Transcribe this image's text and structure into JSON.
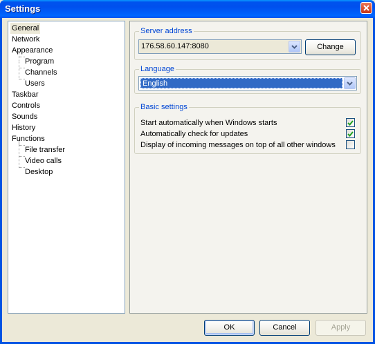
{
  "window": {
    "title": "Settings",
    "close_icon": "close-icon"
  },
  "tree": {
    "items": [
      {
        "label": "General",
        "level": 0,
        "selected": true
      },
      {
        "label": "Network",
        "level": 0
      },
      {
        "label": "Appearance",
        "level": 0
      },
      {
        "label": "Program",
        "level": 1
      },
      {
        "label": "Channels",
        "level": 1
      },
      {
        "label": "Users",
        "level": 1
      },
      {
        "label": "Taskbar",
        "level": 0
      },
      {
        "label": "Controls",
        "level": 0
      },
      {
        "label": "Sounds",
        "level": 0
      },
      {
        "label": "History",
        "level": 0
      },
      {
        "label": "Functions",
        "level": 0
      },
      {
        "label": "File transfer",
        "level": 1
      },
      {
        "label": "Video calls",
        "level": 1
      },
      {
        "label": "Desktop",
        "level": 1
      }
    ]
  },
  "server": {
    "legend": "Server address",
    "value": "176.58.60.147:8080",
    "change_label": "Change"
  },
  "language": {
    "legend": "Language",
    "value": "English"
  },
  "basic": {
    "legend": "Basic settings",
    "options": [
      {
        "label": "Start automatically when Windows starts",
        "checked": true
      },
      {
        "label": "Automatically check for updates",
        "checked": true
      },
      {
        "label": "Display of incoming messages on top of all other windows",
        "checked": false
      }
    ]
  },
  "footer": {
    "ok_label": "OK",
    "cancel_label": "Cancel",
    "apply_label": "Apply"
  },
  "colors": {
    "title_bar": "#0054e3",
    "selection": "#316ac5",
    "legend_text": "#0046d5",
    "check_mark": "#21a121"
  }
}
